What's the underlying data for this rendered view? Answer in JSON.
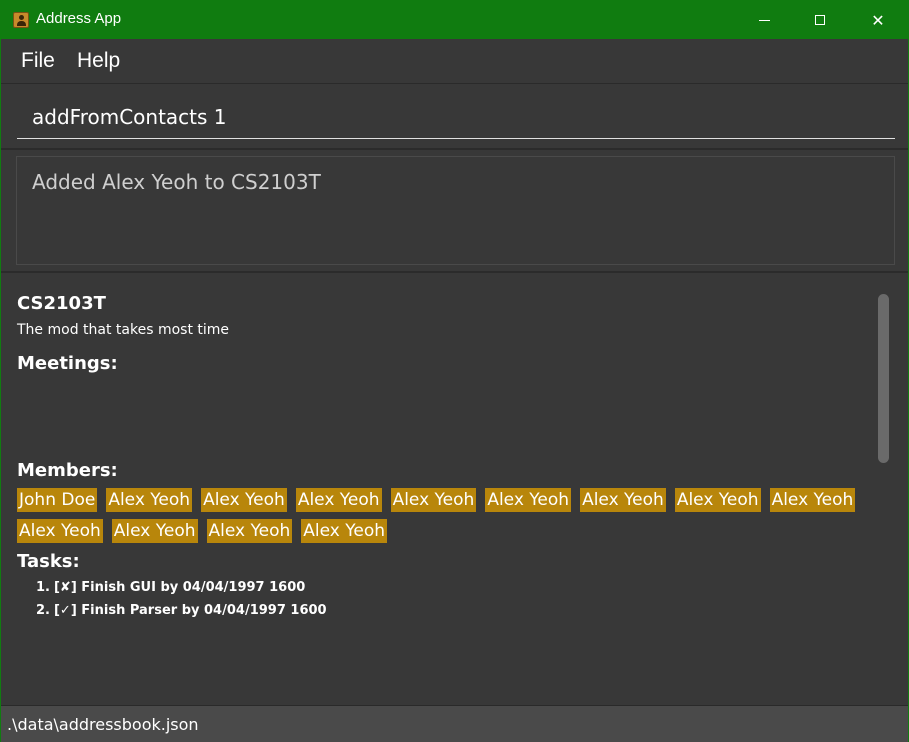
{
  "window": {
    "title": "Address App",
    "colors": {
      "titlebar": "#107c10",
      "background": "#383838",
      "tag": "#b8860b"
    },
    "controls": {
      "minimize_icon": "minimize-icon",
      "maximize_icon": "maximize-icon",
      "close_icon": "close-icon",
      "close_glyph": "✕"
    }
  },
  "menu": {
    "items": [
      {
        "label": "File"
      },
      {
        "label": "Help"
      }
    ]
  },
  "command": {
    "value": "addFromContacts 1"
  },
  "result": {
    "message": "Added Alex Yeoh to CS2103T"
  },
  "group": {
    "name": "CS2103T",
    "description": "The mod that takes most time",
    "meetings_label": "Meetings:",
    "members_label": "Members:",
    "members": [
      "John Doe",
      "Alex Yeoh",
      "Alex Yeoh",
      "Alex Yeoh",
      "Alex Yeoh",
      "Alex Yeoh",
      "Alex Yeoh",
      "Alex Yeoh",
      "Alex Yeoh",
      "Alex Yeoh",
      "Alex Yeoh",
      "Alex Yeoh",
      "Alex Yeoh"
    ],
    "tasks_label": "Tasks:",
    "tasks": [
      {
        "index": "1.",
        "text": "[✘] Finish GUI by 04/04/1997 1600"
      },
      {
        "index": "2.",
        "text": "[✓] Finish Parser by 04/04/1997 1600"
      }
    ]
  },
  "status": {
    "path": ".\\data\\addressbook.json"
  }
}
